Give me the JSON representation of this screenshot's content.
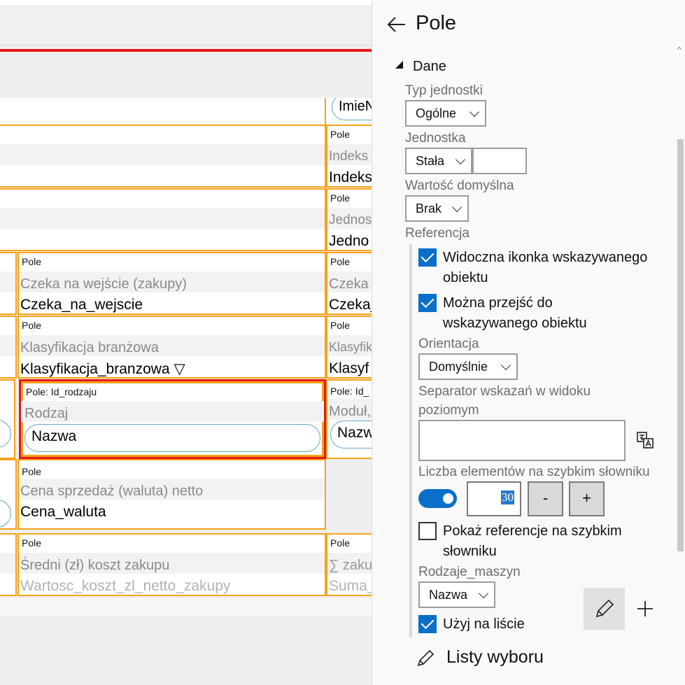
{
  "canvas": {
    "pill_imie": "ImieN",
    "cells": [
      {
        "label": "Pole",
        "caption": "Indeks",
        "field": "Indeks"
      },
      {
        "label": "Pole",
        "caption": "Jednos",
        "field": "Jedno"
      },
      {
        "label": "Pole",
        "caption": "Czeka na wejście (zakupy)",
        "field": "Czeka_na_wejscie"
      },
      {
        "label": "Pole",
        "caption": "Czeka",
        "field": "Czeka_"
      },
      {
        "label": "Pole",
        "caption": "Klasyfikacja branżowa",
        "field": "Klasyfikacja_branzowa ▽"
      },
      {
        "label": "Pole",
        "caption": "Klasyfik",
        "field": "Klasyf"
      },
      {
        "label": "Pole: Id_rodzaju",
        "caption": "Rodzaj",
        "field": "Nazwa"
      },
      {
        "label": "Pole: Id_",
        "caption": "Moduł,",
        "field": "Nazw"
      },
      {
        "label": "Pole",
        "caption": "Cena sprzedaż (waluta) netto",
        "field": "Cena_waluta"
      },
      {
        "label": "Pole",
        "caption": "Średni (zł) koszt zakupu",
        "field": "Wartosc_koszt_zl_netto_zakupy"
      },
      {
        "label": "Pole",
        "caption": "∑ zaku",
        "field": "Suma_"
      }
    ]
  },
  "panel": {
    "title": "Pole",
    "section": "Dane",
    "typ_jednostki": {
      "label": "Typ jednostki",
      "value": "Ogólne"
    },
    "jednostka": {
      "label": "Jednostka",
      "value": "Stała",
      "input": ""
    },
    "wartosc_domyslna": {
      "label": "Wartość domyślna",
      "value": "Brak"
    },
    "referencja": "Referencja",
    "widoczna_ikonka": {
      "line1": "Widoczna ikonka wskazywanego",
      "line2": "obiektu",
      "checked": true
    },
    "mozna_przejsc": {
      "line1": "Można przejść do",
      "line2": "wskazywanego obiektu",
      "checked": true
    },
    "orientacja": {
      "label": "Orientacja",
      "value": "Domyślnie"
    },
    "separator": {
      "line1": "Separator wskazań w widoku",
      "line2": "poziomym",
      "value": ""
    },
    "liczba": {
      "label": "Liczba elementów na szybkim słowniku",
      "toggle_on": true,
      "value": "30",
      "minus": "-",
      "plus": "+"
    },
    "pokaz_ref": {
      "line1": "Pokaż referencje na szybkim",
      "line2": "słowniku",
      "checked": false
    },
    "rodzaje": {
      "label": "Rodzaje_maszyn",
      "value": "Nazwa"
    },
    "uzyj": {
      "label": "Użyj na liście",
      "checked": true
    },
    "listy": "Listy wyboru",
    "colors": {
      "accent": "#0a6fc8",
      "selection": "#e8171b",
      "cell_border": "#f5a31a"
    }
  }
}
